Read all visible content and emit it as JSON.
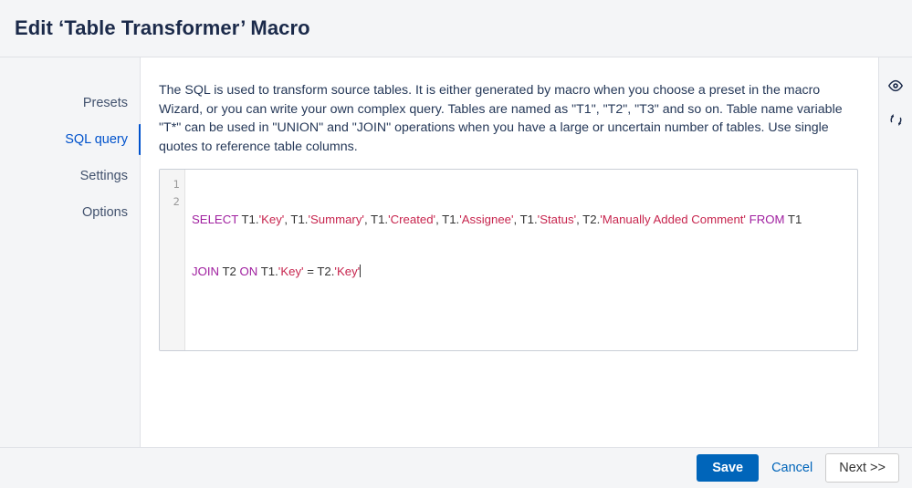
{
  "header": {
    "title": "Edit ‘Table Transformer’ Macro"
  },
  "sidebar": {
    "items": [
      {
        "label": "Presets",
        "active": false
      },
      {
        "label": "SQL query",
        "active": true
      },
      {
        "label": "Settings",
        "active": false
      },
      {
        "label": "Options",
        "active": false
      }
    ]
  },
  "main": {
    "description": "The SQL is used to transform source tables. It is either generated by macro when you choose a preset in the macro Wizard, or you can write your own complex query. Tables are named as \"T1\", \"T2\", \"T3\" and so on. Table name variable \"T*\" can be used in \"UNION\" and \"JOIN\" operations when you have a large or uncertain number of tables. Use single quotes to reference table columns.",
    "editor": {
      "line_numbers": [
        "1",
        "2"
      ],
      "lines": [
        [
          {
            "t": "SELECT",
            "c": "kw"
          },
          {
            "t": " T1.",
            "c": "id"
          },
          {
            "t": "'Key'",
            "c": "str"
          },
          {
            "t": ", T1.",
            "c": "id"
          },
          {
            "t": "'Summary'",
            "c": "str"
          },
          {
            "t": ", T1.",
            "c": "id"
          },
          {
            "t": "'Created'",
            "c": "str"
          },
          {
            "t": ", T1.",
            "c": "id"
          },
          {
            "t": "'Assignee'",
            "c": "str"
          },
          {
            "t": ", T1.",
            "c": "id"
          },
          {
            "t": "'Status'",
            "c": "str"
          },
          {
            "t": ", T2.",
            "c": "id"
          },
          {
            "t": "'Manually Added Comment'",
            "c": "str"
          },
          {
            "t": " ",
            "c": "id"
          },
          {
            "t": "FROM",
            "c": "kw"
          },
          {
            "t": " T1",
            "c": "id"
          }
        ],
        [
          {
            "t": "JOIN",
            "c": "kw"
          },
          {
            "t": " T2 ",
            "c": "id"
          },
          {
            "t": "ON",
            "c": "kw"
          },
          {
            "t": " T1.",
            "c": "id"
          },
          {
            "t": "'Key'",
            "c": "str"
          },
          {
            "t": " = T2.",
            "c": "id"
          },
          {
            "t": "'Key'",
            "c": "str"
          }
        ]
      ],
      "full_text": "SELECT T1.'Key', T1.'Summary', T1.'Created', T1.'Assignee', T1.'Status', T2.'Manually Added Comment' FROM T1\nJOIN T2 ON T1.'Key' = T2.'Key'"
    }
  },
  "right_rail": {
    "items": [
      {
        "icon": "eye-icon",
        "name": "preview-toggle"
      },
      {
        "icon": "refresh-icon",
        "name": "refresh-button"
      }
    ]
  },
  "footer": {
    "save_label": "Save",
    "cancel_label": "Cancel",
    "next_label": "Next >>"
  },
  "colors": {
    "accent": "#0052cc",
    "button_primary": "#0065ba",
    "panel_bg": "#f4f5f7",
    "keyword": "#a020a0",
    "string": "#c7254e",
    "text": "#172b4d"
  }
}
